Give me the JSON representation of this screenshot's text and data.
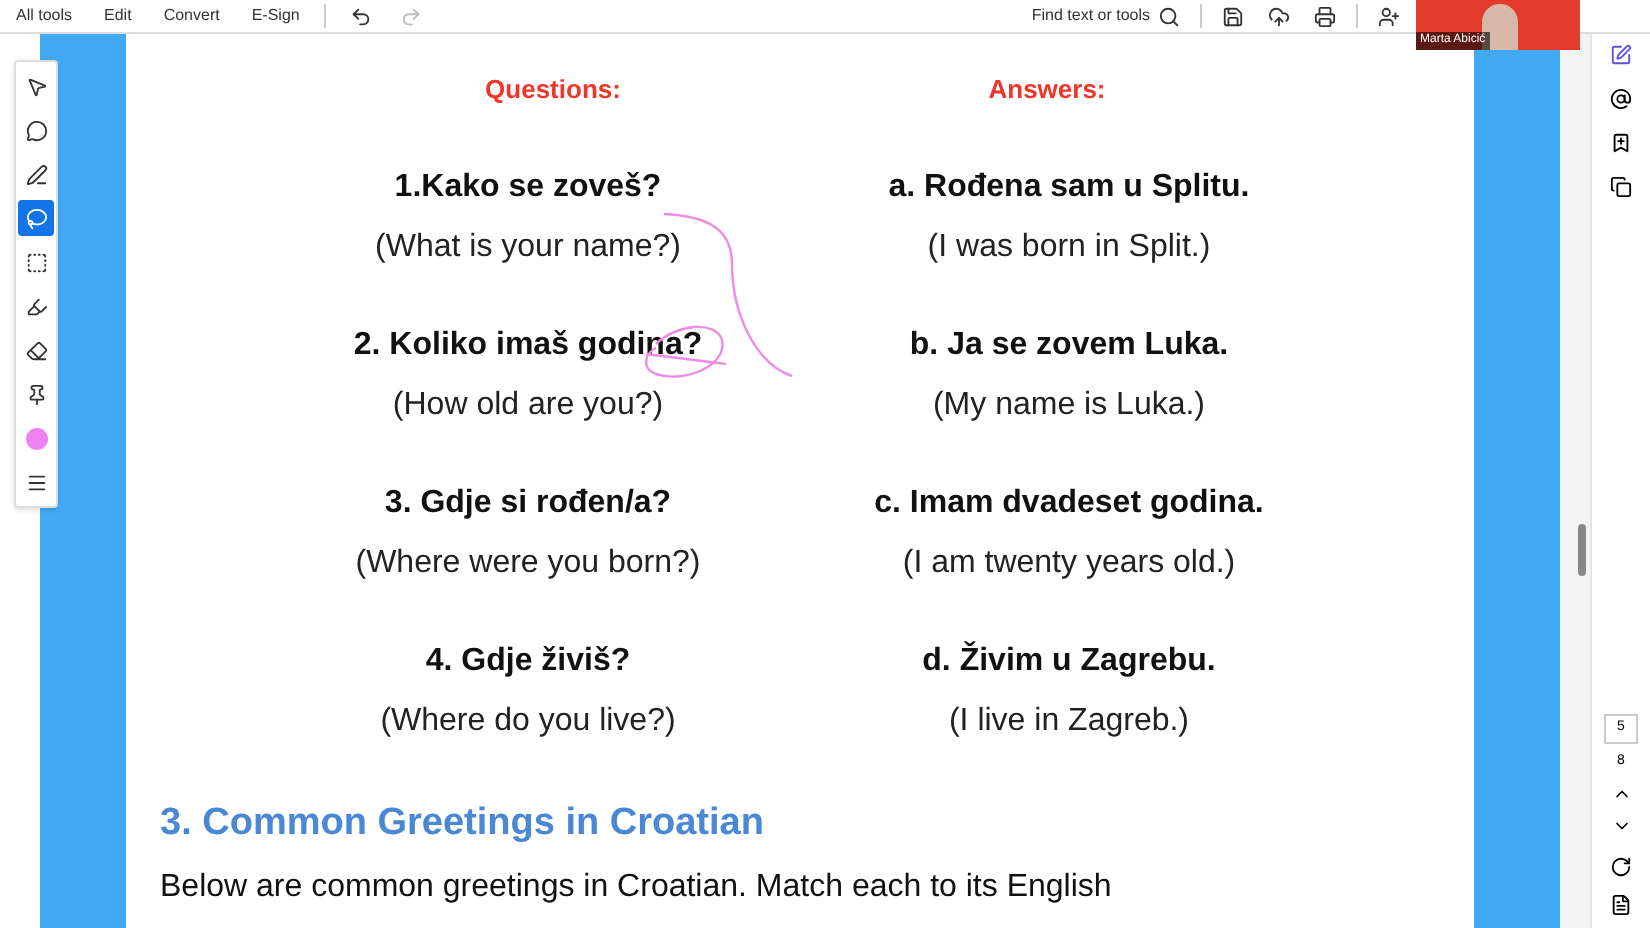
{
  "menu": [
    "All tools",
    "Edit",
    "Convert",
    "E-Sign"
  ],
  "find": {
    "placeholder": "Find text or tools"
  },
  "video_tile": {
    "name": "Marta Abicić"
  },
  "tools": [
    {
      "kind": "tool",
      "selected": false
    },
    {
      "kind": "tool",
      "selected": false
    },
    {
      "kind": "tool",
      "selected": false
    },
    {
      "kind": "tool",
      "selected": true
    },
    {
      "kind": "tool",
      "selected": false
    },
    {
      "kind": "tool",
      "selected": false
    },
    {
      "kind": "tool",
      "selected": false
    },
    {
      "kind": "tool",
      "selected": false
    },
    {
      "kind": "color",
      "color": "#ee82ee"
    },
    {
      "kind": "tool",
      "selected": false
    }
  ],
  "columns": {
    "questions": "Questions:",
    "answers": "Answers:"
  },
  "pairs": [
    {
      "question": "1.Kako se zoveš?",
      "question_en": "(What is your name?)",
      "answer": "a. Rođena sam u Splitu.",
      "answer_en": "(I was born in Split.)"
    },
    {
      "question": "2. Koliko imaš godina?",
      "question_en": "(How old are you?)",
      "answer": "b. Ja se zovem Luka.",
      "answer_en": "(My name is Luka.)"
    },
    {
      "question": "3. Gdje si rođen/a?",
      "question_en": "(Where were you born?)",
      "answer": "c. Imam dvadeset godina.",
      "answer_en": "(I am twenty years old.)"
    },
    {
      "question": "4. Gdje živiš?",
      "question_en": "(Where do you live?)",
      "answer": "d. Živim u Zagrebu.",
      "answer_en": "(I live in Zagreb.)"
    }
  ],
  "section": {
    "heading": "3. Common Greetings in Croatian",
    "text": "Below are common greetings in Croatian. Match each to its English"
  },
  "pager": {
    "current": "5",
    "total": "8"
  }
}
